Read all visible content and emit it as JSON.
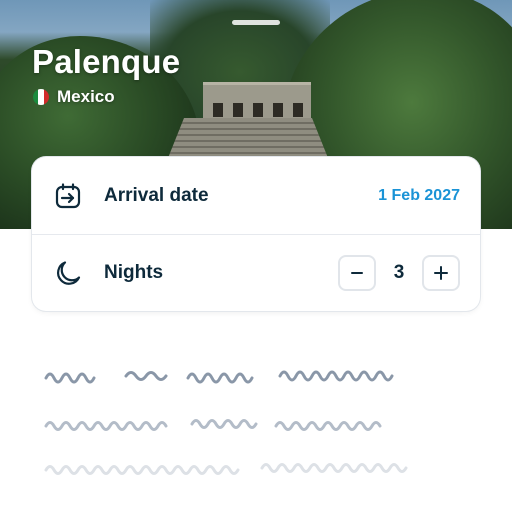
{
  "place": {
    "title": "Palenque",
    "country": "Mexico",
    "flag_icon": "mexico-flag-icon",
    "flag_colors": [
      "#1b8a3d",
      "#ffffff",
      "#d12b2b"
    ]
  },
  "booking": {
    "arrival": {
      "label": "Arrival date",
      "value": "1 Feb 2027",
      "icon": "calendar-arrow-icon"
    },
    "nights": {
      "label": "Nights",
      "value": "3",
      "icon": "moon-icon",
      "decrement_icon": "minus-icon",
      "increment_icon": "plus-icon"
    }
  },
  "colors": {
    "accent": "#1a93d6",
    "text_primary": "#0e2a3b",
    "border": "#e1e5ea",
    "skeleton_dark": "#8a97a8",
    "skeleton_mid": "#b3bcc8",
    "skeleton_light": "#dde1e6"
  }
}
